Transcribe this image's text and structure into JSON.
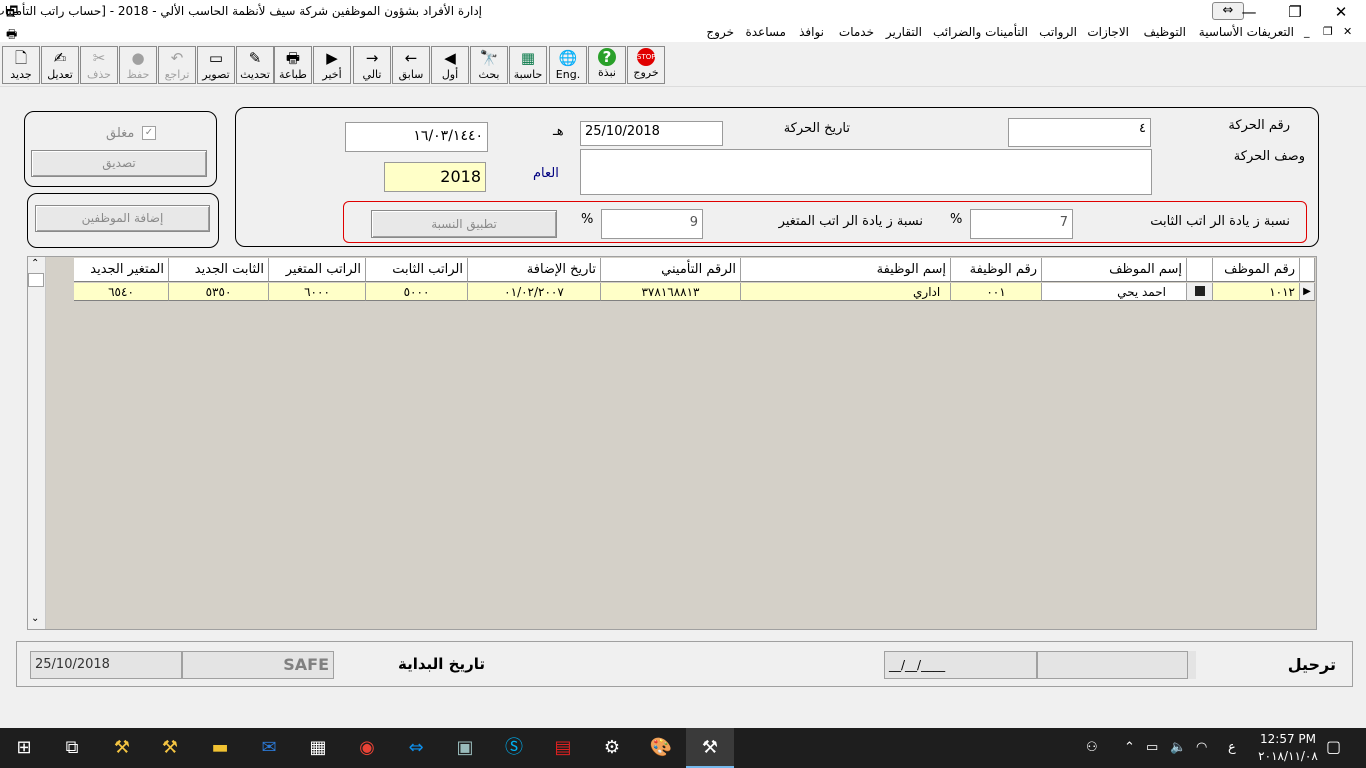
{
  "window": {
    "title": "إدارة الأفراد بشؤون الموظفين شركة سيف لأنظمة الحاسب الألي - 2018 - [حساب راتب التأمينات]",
    "controls": {
      "minimize": "—",
      "restore": "❐",
      "close": "✕",
      "swap": "⇔"
    }
  },
  "menu": {
    "items": [
      "التعريفات الأساسية",
      "التوظيف",
      "الاجازات",
      "الرواتب",
      "التأمينات والضرائب",
      "التقارير",
      "خدمات",
      "نوافذ",
      "مساعدة",
      "خروج"
    ],
    "mdi_controls": {
      "close": "✕",
      "restore": "❐",
      "minimize": "_"
    }
  },
  "toolbar": [
    {
      "label": "خروج",
      "icon": "stop-icon",
      "glyph": "STOP",
      "enabled": true
    },
    {
      "label": "نبذة",
      "icon": "help-icon",
      "glyph": "?",
      "enabled": true
    },
    {
      "label": "Eng.",
      "icon": "globe-icon",
      "glyph": "🌐",
      "enabled": true
    },
    {
      "label": "حاسبة",
      "icon": "calculator-icon",
      "glyph": "▦",
      "enabled": true
    },
    {
      "label": "بحث",
      "icon": "binoculars-icon",
      "glyph": "🔭",
      "enabled": true
    },
    {
      "label": "أول",
      "icon": "first-icon",
      "glyph": "◀",
      "enabled": true
    },
    {
      "label": "سابق",
      "icon": "prev-icon",
      "glyph": "←",
      "enabled": true
    },
    {
      "label": "تالي",
      "icon": "next-icon",
      "glyph": "→",
      "enabled": true
    },
    {
      "label": "أخير",
      "icon": "last-icon",
      "glyph": "▶",
      "enabled": true
    },
    {
      "label": "طباعة",
      "icon": "printer-icon",
      "glyph": "🖶",
      "enabled": true
    },
    {
      "label": "تحديث",
      "icon": "refresh-icon",
      "glyph": "✎",
      "enabled": true
    },
    {
      "label": "تصوير",
      "icon": "scanner-icon",
      "glyph": "▭",
      "enabled": true
    },
    {
      "label": "تراجع",
      "icon": "undo-icon",
      "glyph": "↶",
      "enabled": false
    },
    {
      "label": "حفظ",
      "icon": "save-icon",
      "glyph": "●",
      "enabled": false
    },
    {
      "label": "حذف",
      "icon": "cut-icon",
      "glyph": "✂",
      "enabled": false
    },
    {
      "label": "تعديل",
      "icon": "edit-icon",
      "glyph": "✍",
      "enabled": true
    },
    {
      "label": "جديد",
      "icon": "new-file-icon",
      "glyph": "🗋",
      "enabled": true
    }
  ],
  "form": {
    "movement_no_label": "رقم الحركة",
    "movement_no_value": "٤",
    "movement_date_label": "تاريخ الحركة",
    "movement_date_value": "25/10/2018",
    "hijri_suffix": "هـ",
    "hijri_date_value": "١٦/٠٣/١٤٤٠",
    "description_label": "وصف الحركة",
    "description_value": "",
    "year_label": "العام",
    "year_value": "2018",
    "fixed_pct_label": "نسبة ز يادة الر اتب الثابت",
    "fixed_pct_value": "7",
    "variable_pct_label": "نسبة ز يادة الر اتب المتغير",
    "variable_pct_value": "9",
    "pct_sign": "%",
    "apply_pct_button": "تطبيق النسبة",
    "closed_label": "مغلق",
    "confirm_button": "تصديق",
    "add_employees_button": "إضافة الموظفين"
  },
  "grid": {
    "columns": [
      "رقم الموظف",
      "",
      "إسم الموظف",
      "رقم الوظيفة",
      "إسم الوظيفة",
      "الرقم التأميني",
      "تاريخ الإضافة",
      "الراتب الثابت",
      "الراتب المتغير",
      "الثابت الجديد",
      "المتغير الجديد"
    ],
    "rows": [
      {
        "emp_no": "١٠١٢",
        "emp_name": "احمد يحي",
        "job_no": "٠٠١",
        "job_name": "اداري",
        "insurance_no": "٣٧٨١٦٨٨١٣",
        "added_date": "٠١/٠٢/٢٠٠٧",
        "fixed_salary": "٥٠٠٠",
        "variable_salary": "٦٠٠٠",
        "new_fixed": "٥٣٥٠",
        "new_variable": "٦٥٤٠"
      }
    ]
  },
  "status": {
    "post_label": "ترحيل",
    "post_date": "__/__/____",
    "start_label": "تاريخ البداية",
    "user": "SAFE",
    "date": "25/10/2018"
  },
  "taskbar": {
    "time": "12:57 PM",
    "date": "٢٠١٨/١١/٠٨",
    "lang": "ع"
  }
}
